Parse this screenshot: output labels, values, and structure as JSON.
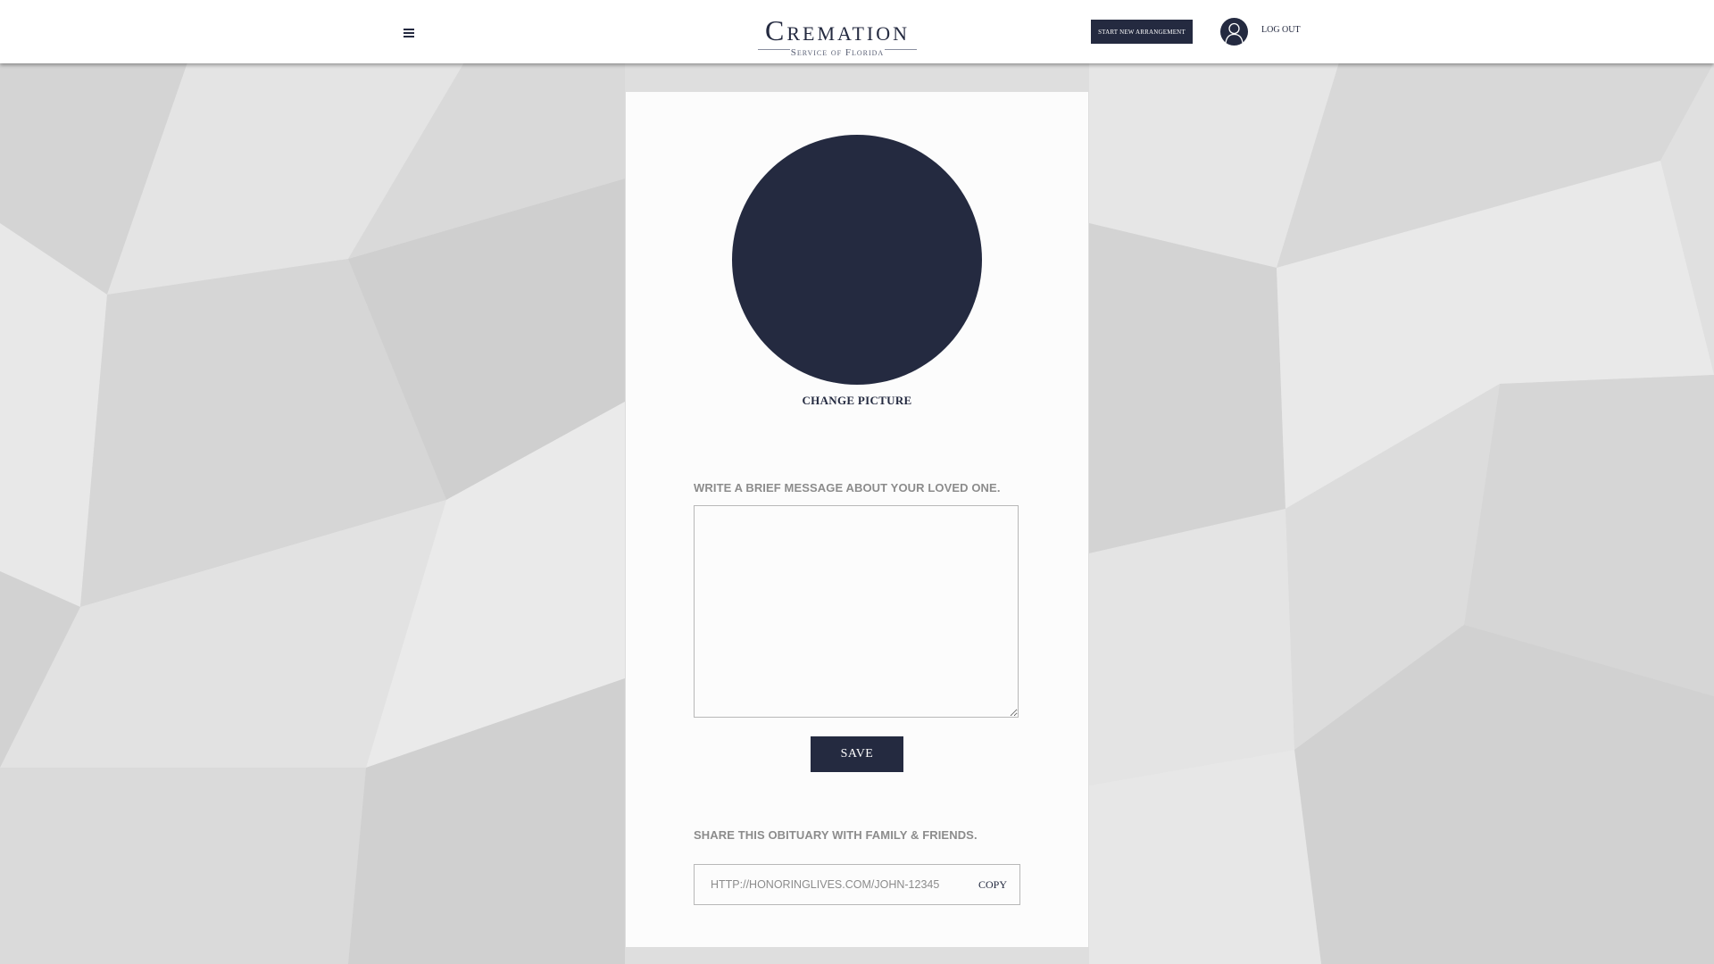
{
  "header": {
    "logo_main": "Cremation",
    "logo_sub": "Service of Florida",
    "start_button_label": "Start New Arrangement",
    "logout_label": "Log Out"
  },
  "profile": {
    "change_picture_label": "Change Picture"
  },
  "message": {
    "label": "Write a brief message about your loved one.",
    "value": "",
    "save_label": "Save"
  },
  "share": {
    "label": "Share this obituary with family & friends.",
    "url": "http://honoringlives.com/john-12345",
    "copy_label": "Copy"
  },
  "colors": {
    "brand_navy": "#242a40",
    "background": "#dcdcdc",
    "card": "#fcfcfc",
    "label_gray": "#8c8c8c"
  },
  "icons": {
    "menu": "hamburger-menu-icon",
    "avatar": "user-avatar-icon"
  }
}
